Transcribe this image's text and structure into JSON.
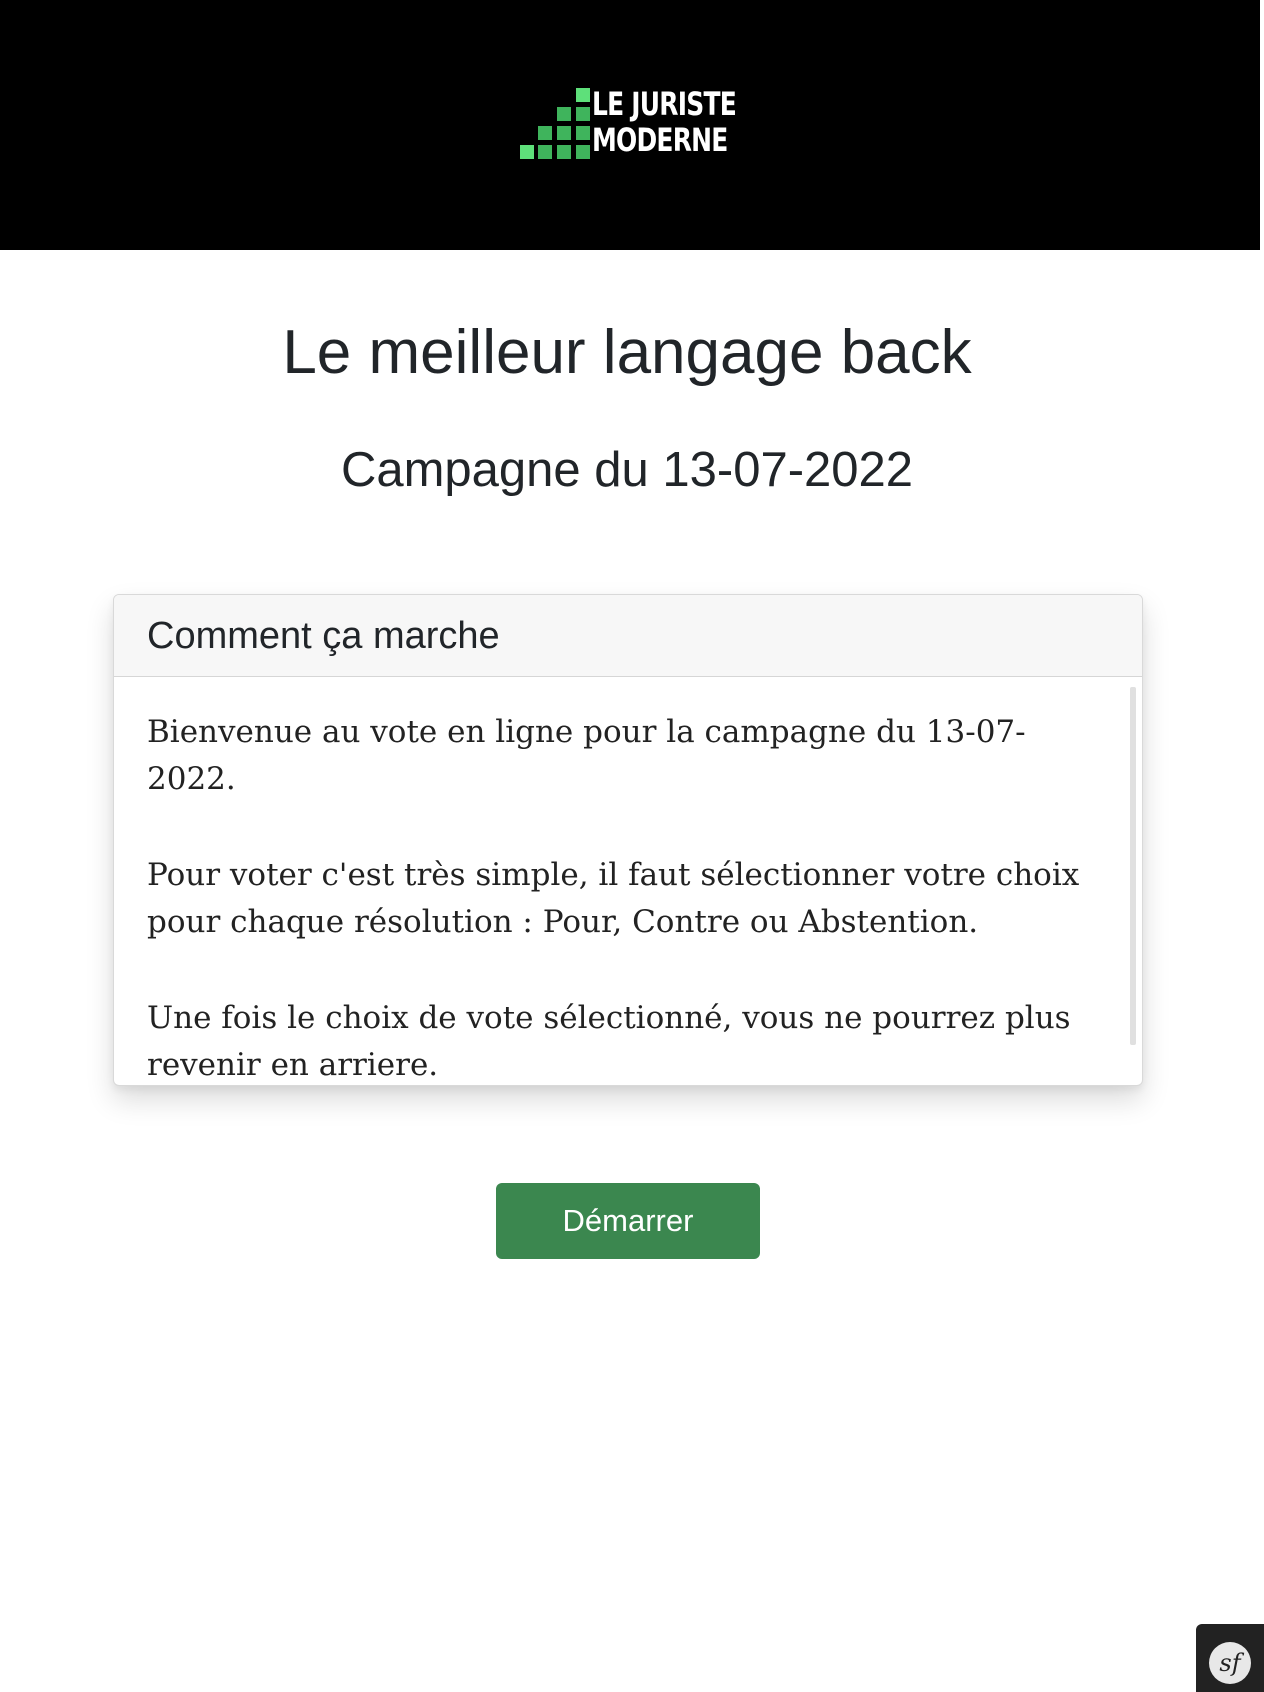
{
  "header": {
    "logo": {
      "line1": "LE JURISTE",
      "line2": "MODERNE",
      "colors": {
        "green_bright": "#5ee07a",
        "green_mid": "#3fb45c",
        "green_dark": "#2f8c45"
      }
    }
  },
  "page": {
    "title": "Le meilleur langage back",
    "subtitle": "Campagne du 13-07-2022"
  },
  "card": {
    "header": "Comment ça marche",
    "paragraphs": [
      "Bienvenue au vote en ligne pour la campagne du 13-07-2022.",
      "Pour voter c'est très simple, il faut sélectionner votre choix pour chaque résolution : Pour, Contre ou Abstention.",
      "Une fois le choix de vote sélectionné, vous ne pourrez plus revenir en arriere."
    ]
  },
  "actions": {
    "start_label": "Démarrer",
    "start_color": "#3b874f"
  },
  "debug_toolbar": {
    "icon": "symfony-icon",
    "glyph": "sf"
  }
}
